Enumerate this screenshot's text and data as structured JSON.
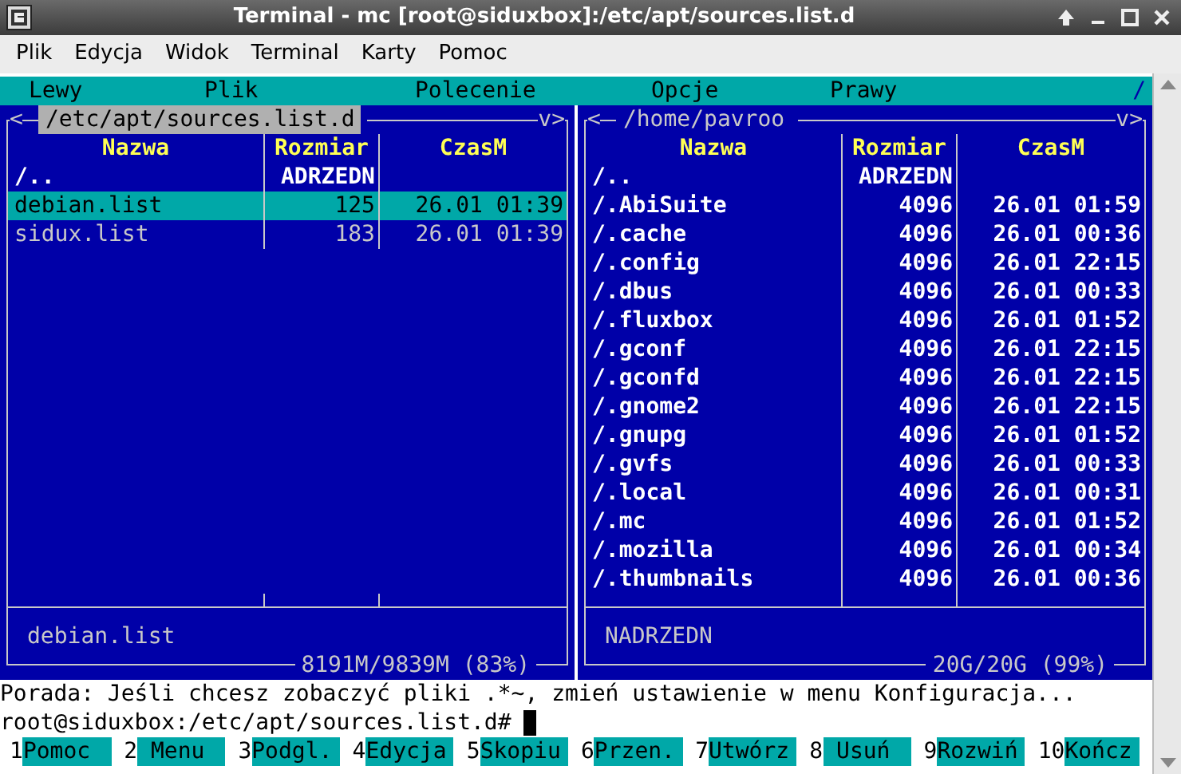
{
  "window": {
    "title": "Terminal - mc [root@siduxbox]:/etc/apt/sources.list.d"
  },
  "menu": [
    {
      "label": "Plik"
    },
    {
      "label": "Edycja"
    },
    {
      "label": "Widok"
    },
    {
      "label": "Terminal"
    },
    {
      "label": "Karty"
    },
    {
      "label": "Pomoc"
    }
  ],
  "mc_menu": [
    {
      "label": "Lewy"
    },
    {
      "label": "Plik"
    },
    {
      "label": "Polecenie"
    },
    {
      "label": "Opcje"
    },
    {
      "label": "Prawy"
    }
  ],
  "mc_menu_end": "/",
  "panels": [
    {
      "left_mark": "<",
      "path": "/etc/apt/sources.list.d",
      "path_active": true,
      "right_mark": "v>",
      "columns": [
        "Nazwa",
        "Rozmiar",
        "CzasM"
      ],
      "rows": [
        {
          "kind": "updir",
          "name": "/..",
          "size": "ADRZEDN",
          "time": "",
          "selected": false
        },
        {
          "kind": "file",
          "name": "debian.list",
          "size": "125",
          "time": "26.01 01:39",
          "selected": true
        },
        {
          "kind": "file",
          "name": "sidux.list",
          "size": "183",
          "time": "26.01 01:39",
          "selected": false
        }
      ],
      "mini_status": "debian.list",
      "disk": "8191M/9839M (83%)"
    },
    {
      "left_mark": "<",
      "path": "/home/pavroo",
      "path_active": false,
      "right_mark": "v>",
      "columns": [
        "Nazwa",
        "Rozmiar",
        "CzasM"
      ],
      "rows": [
        {
          "kind": "updir",
          "name": "/..",
          "size": "ADRZEDN",
          "time": "",
          "selected": false
        },
        {
          "kind": "dir",
          "name": "/.AbiSuite",
          "size": "4096",
          "time": "26.01 01:59",
          "selected": false
        },
        {
          "kind": "dir",
          "name": "/.cache",
          "size": "4096",
          "time": "26.01 00:36",
          "selected": false
        },
        {
          "kind": "dir",
          "name": "/.config",
          "size": "4096",
          "time": "26.01 22:15",
          "selected": false
        },
        {
          "kind": "dir",
          "name": "/.dbus",
          "size": "4096",
          "time": "26.01 00:33",
          "selected": false
        },
        {
          "kind": "dir",
          "name": "/.fluxbox",
          "size": "4096",
          "time": "26.01 01:52",
          "selected": false
        },
        {
          "kind": "dir",
          "name": "/.gconf",
          "size": "4096",
          "time": "26.01 22:15",
          "selected": false
        },
        {
          "kind": "dir",
          "name": "/.gconfd",
          "size": "4096",
          "time": "26.01 22:15",
          "selected": false
        },
        {
          "kind": "dir",
          "name": "/.gnome2",
          "size": "4096",
          "time": "26.01 22:15",
          "selected": false
        },
        {
          "kind": "dir",
          "name": "/.gnupg",
          "size": "4096",
          "time": "26.01 01:52",
          "selected": false
        },
        {
          "kind": "dir",
          "name": "/.gvfs",
          "size": "4096",
          "time": "26.01 00:33",
          "selected": false
        },
        {
          "kind": "dir",
          "name": "/.local",
          "size": "4096",
          "time": "26.01 00:31",
          "selected": false
        },
        {
          "kind": "dir",
          "name": "/.mc",
          "size": "4096",
          "time": "26.01 01:52",
          "selected": false
        },
        {
          "kind": "dir",
          "name": "/.mozilla",
          "size": "4096",
          "time": "26.01 00:34",
          "selected": false
        },
        {
          "kind": "dir",
          "name": "/.thumbnails",
          "size": "4096",
          "time": "26.01 00:36",
          "selected": false
        }
      ],
      "mini_status": "NADRZEDN",
      "disk": "20G/20G (99%)"
    }
  ],
  "hint": "Porada: Jeśli chcesz zobaczyć pliki .*~, zmień ustawienie w menu Konfiguracja...",
  "prompt": "root@siduxbox:/etc/apt/sources.list.d#",
  "fkeys": [
    {
      "number": "1",
      "label": "Pomoc"
    },
    {
      "number": "2",
      "label": " Menu"
    },
    {
      "number": "3",
      "label": "Podgl."
    },
    {
      "number": "4",
      "label": "Edycja"
    },
    {
      "number": "5",
      "label": "Skopiu"
    },
    {
      "number": "6",
      "label": "Przen."
    },
    {
      "number": "7",
      "label": "Utwórz"
    },
    {
      "number": "8",
      "label": " Usuń"
    },
    {
      "number": "9",
      "label": "Rozwiń"
    },
    {
      "number": "10",
      "label": "Kończ"
    }
  ]
}
